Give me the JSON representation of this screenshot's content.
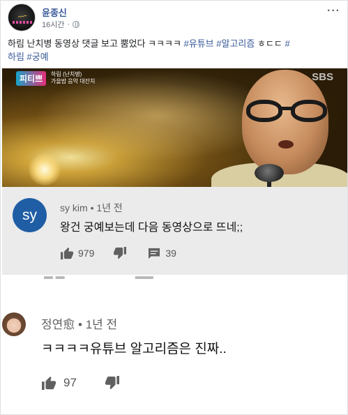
{
  "post": {
    "page_name": "윤종신",
    "time": "16시간",
    "text_main": "하림 난치병 동영상 댓글 보고 뿜었다 ㅋㅋㅋㅋ ",
    "hashtags_line1": [
      "#유튜브",
      "#알고리즘"
    ],
    "text_mid": " ㅎㄷㄷ ",
    "hashtags_line1_end": "#",
    "hashtags_line2_start": "하림",
    "hashtags_line2": [
      "#궁예"
    ]
  },
  "video": {
    "show_logo": "피티쁘",
    "show_caption_1": "하림 (난치병)",
    "show_caption_2": "가을밤 음악 대잔치",
    "broadcaster": "SBS"
  },
  "comment1": {
    "avatar_text": "sy",
    "author": "sy kim",
    "age": "1년 전",
    "text": "왕건 궁예보는데 다음 동영상으로 뜨네;;",
    "likes": "979",
    "replies": "39"
  },
  "comment2": {
    "author": "정연愈",
    "age": "1년 전",
    "text": "ㅋㅋㅋㅋ유튜브 알고리즘은 진짜..",
    "likes": "97"
  },
  "colors": {
    "link": "#385898",
    "comment_bg": "#ebebeb",
    "avatar_sy": "#1f5ea5"
  }
}
